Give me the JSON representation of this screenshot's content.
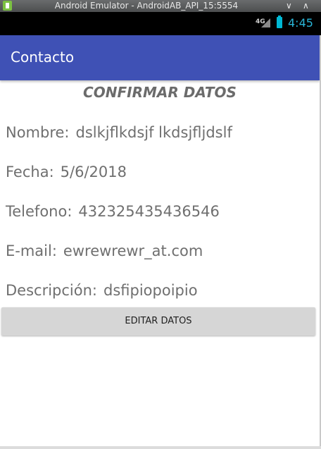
{
  "window": {
    "title": "Android Emulator - AndroidAB_API_15:5554",
    "minimize_glyph": "∨",
    "maximize_glyph": "∧"
  },
  "status_bar": {
    "network": "4G",
    "time": "4:45"
  },
  "app_bar": {
    "title": "Contacto"
  },
  "content": {
    "heading": "CONFIRMAR DATOS",
    "fields": [
      {
        "label": "Nombre:",
        "value": "dslkjflkdsjf lkdsjfljdslf"
      },
      {
        "label": "Fecha:",
        "value": "5/6/2018"
      },
      {
        "label": "Telefono:",
        "value": "432325435436546"
      },
      {
        "label": "E-mail:",
        "value": "ewrewrewr_at.com"
      },
      {
        "label": "Descripción:",
        "value": "dsfipiopoipio"
      }
    ],
    "edit_button_label": "EDITAR DATOS"
  },
  "colors": {
    "app_bar": "#3f51b5",
    "text": "#6f6f6f",
    "button": "#d6d6d6"
  }
}
